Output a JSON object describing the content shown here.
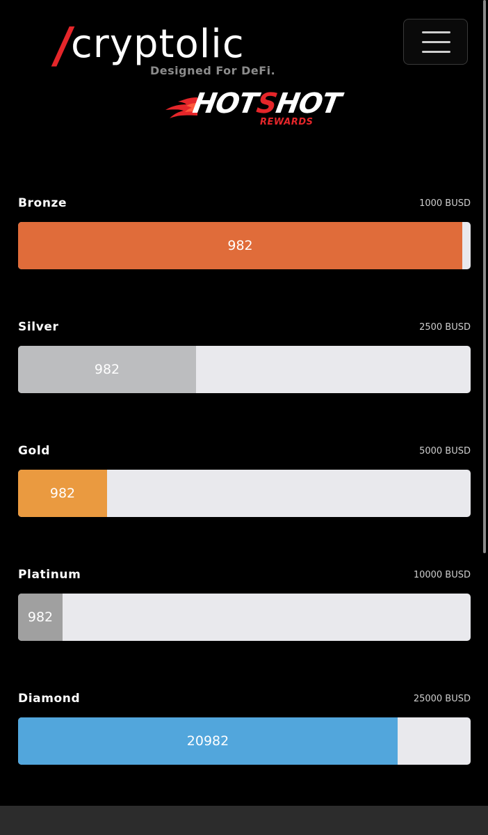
{
  "brand": {
    "slash": "/",
    "name": "cryptolic",
    "tagline": "Designed For DeFi."
  },
  "menu": {
    "icon": "hamburger-icon"
  },
  "promo": {
    "title_part1": "HOT",
    "title_part2": "S",
    "title_part3": "HOT",
    "subtitle": "REWARDS",
    "icon": "flame-icon"
  },
  "tiers": [
    {
      "name": "Bronze",
      "target": "1000 BUSD",
      "progress_label": "982",
      "progress_fraction": 0.982,
      "color": "#e06c3a"
    },
    {
      "name": "Silver",
      "target": "2500 BUSD",
      "progress_label": "982",
      "progress_fraction": 0.393,
      "color": "#bcbdbf"
    },
    {
      "name": "Gold",
      "target": "5000 BUSD",
      "progress_label": "982",
      "progress_fraction": 0.196,
      "color": "#ea9a40"
    },
    {
      "name": "Platinum",
      "target": "10000 BUSD",
      "progress_label": "982",
      "progress_fraction": 0.098,
      "color": "#a0a0a0"
    },
    {
      "name": "Diamond",
      "target": "25000 BUSD",
      "progress_label": "20982",
      "progress_fraction": 0.839,
      "color": "#52a6dc"
    }
  ]
}
